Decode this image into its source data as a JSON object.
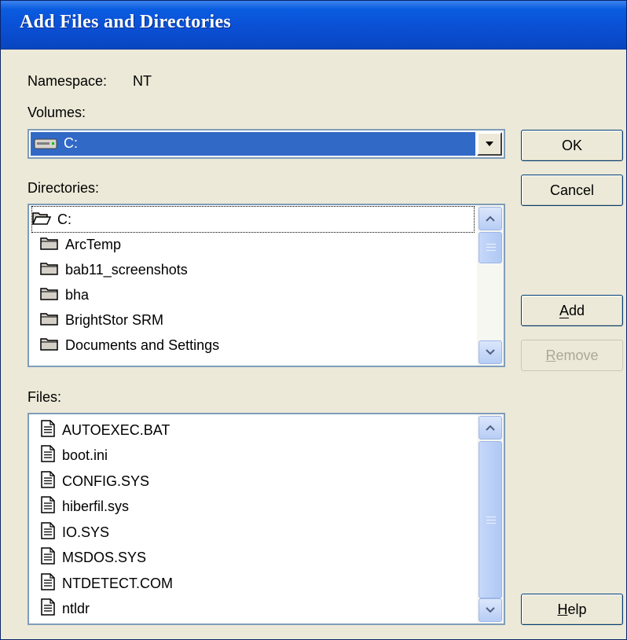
{
  "window": {
    "title": "Add Files and Directories"
  },
  "namespace": {
    "label": "Namespace:",
    "value": "NT"
  },
  "volumes": {
    "label": "Volumes:",
    "selected": "C:"
  },
  "directories": {
    "label": "Directories:",
    "items": [
      {
        "label": "C:",
        "icon": "open-folder-icon"
      },
      {
        "label": "ArcTemp",
        "icon": "folder-icon"
      },
      {
        "label": "bab11_screenshots",
        "icon": "folder-icon"
      },
      {
        "label": "bha",
        "icon": "folder-icon"
      },
      {
        "label": "BrightStor SRM",
        "icon": "folder-icon"
      },
      {
        "label": "Documents and Settings",
        "icon": "folder-icon"
      }
    ]
  },
  "files": {
    "label": "Files:",
    "items": [
      {
        "label": "AUTOEXEC.BAT",
        "icon": "file-icon"
      },
      {
        "label": "boot.ini",
        "icon": "file-icon"
      },
      {
        "label": "CONFIG.SYS",
        "icon": "file-icon"
      },
      {
        "label": "hiberfil.sys",
        "icon": "file-icon"
      },
      {
        "label": "IO.SYS",
        "icon": "file-icon"
      },
      {
        "label": "MSDOS.SYS",
        "icon": "file-icon"
      },
      {
        "label": "NTDETECT.COM",
        "icon": "file-icon"
      },
      {
        "label": "ntldr",
        "icon": "file-icon"
      }
    ]
  },
  "buttons": {
    "ok": "OK",
    "cancel": "Cancel",
    "add": "Add",
    "remove": "Remove",
    "help": "Help"
  },
  "colors": {
    "titlebar": "#0a4fd4",
    "selection": "#3169c6",
    "dialog_bg": "#ece9d8"
  }
}
